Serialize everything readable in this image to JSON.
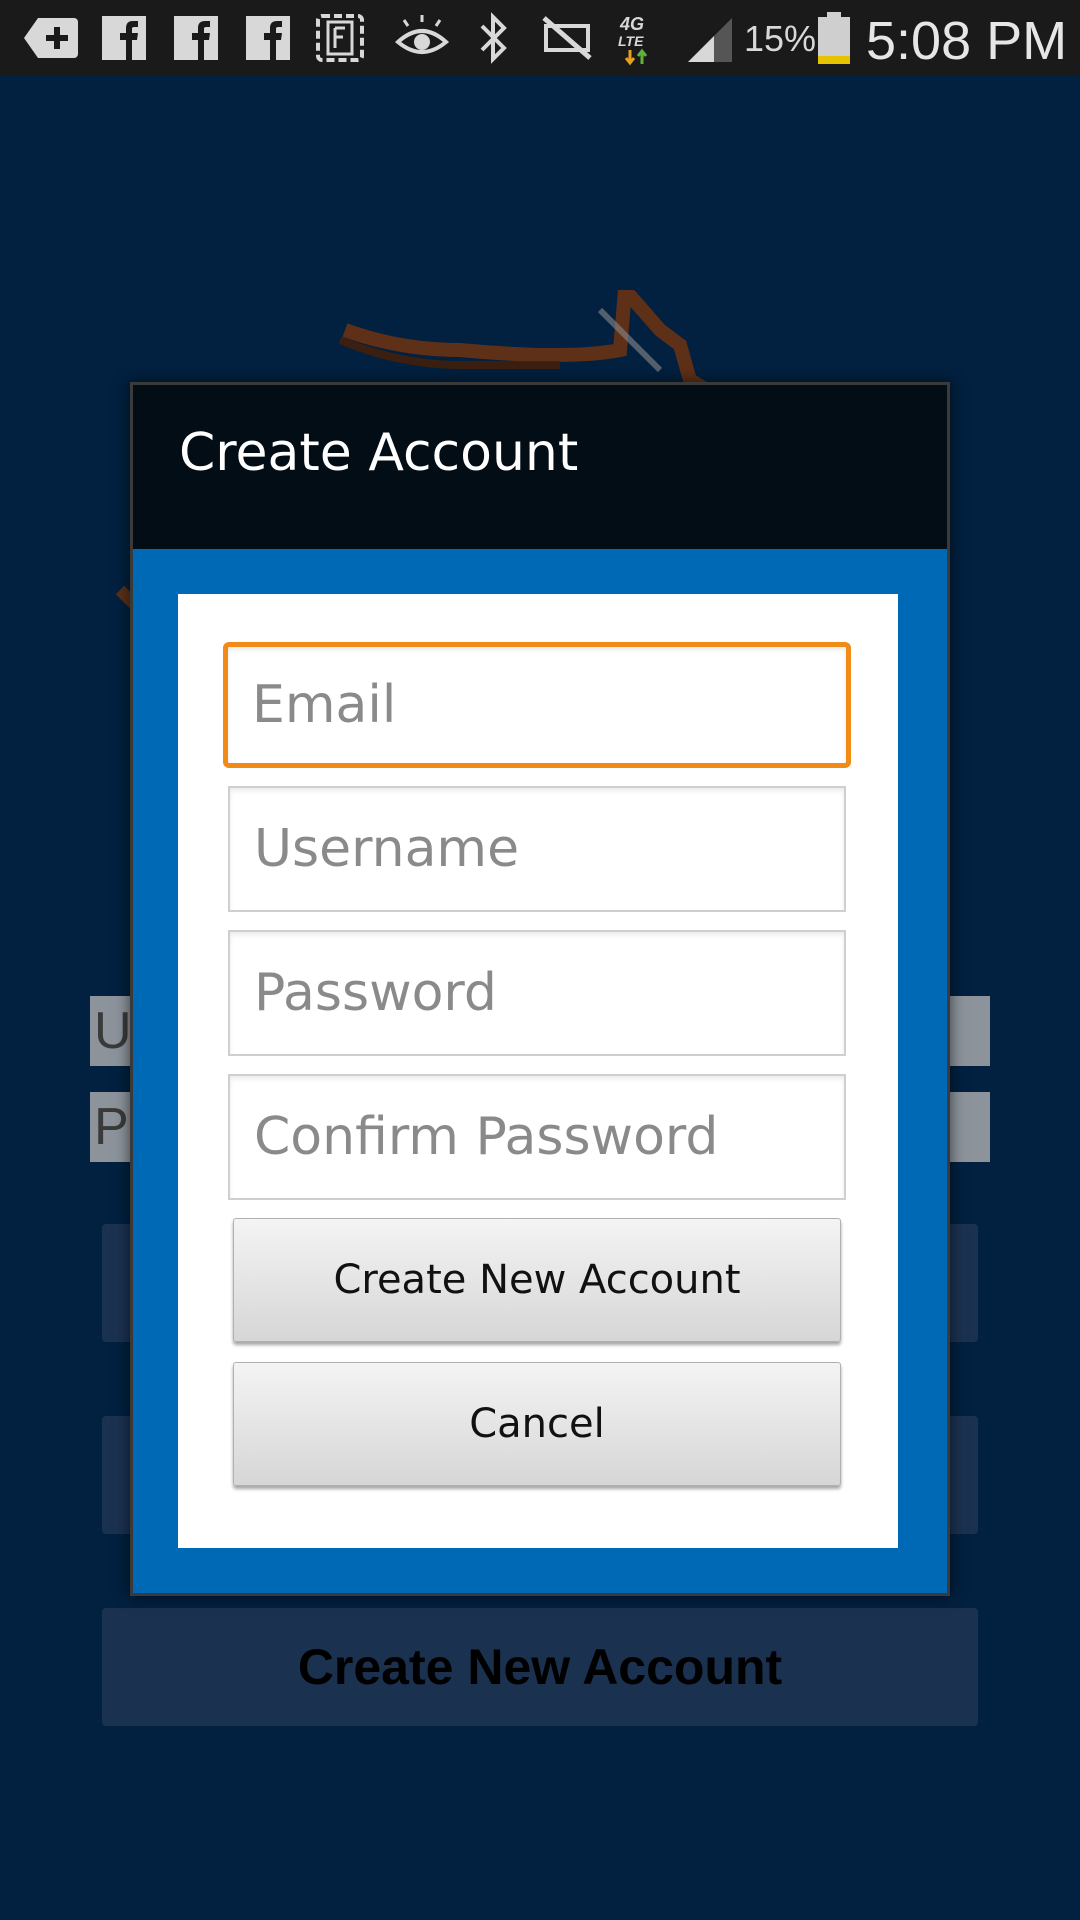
{
  "status_bar": {
    "icons": [
      "add-notification-icon",
      "facebook-icon",
      "facebook-icon",
      "facebook-icon",
      "flipboard-icon",
      "eye-icon",
      "bluetooth-icon",
      "mute-icon",
      "4g-lte-icon",
      "signal-icon",
      "battery-icon"
    ],
    "network_label": "4G LTE",
    "battery_percent": "15%",
    "time": "5:08 PM"
  },
  "background": {
    "username_partial": "U",
    "password_partial": "P",
    "create_button_label": "Create New Account"
  },
  "dialog": {
    "title": "Create Account",
    "fields": {
      "email_placeholder": "Email",
      "username_placeholder": "Username",
      "password_placeholder": "Password",
      "confirm_password_placeholder": "Confirm Password"
    },
    "create_button_label": "Create New Account",
    "cancel_button_label": "Cancel"
  },
  "colors": {
    "background": "#02203f",
    "dialog_frame": "#0069b5",
    "focus_border": "#f28a17",
    "logo_stroke": "#7a3a10"
  }
}
